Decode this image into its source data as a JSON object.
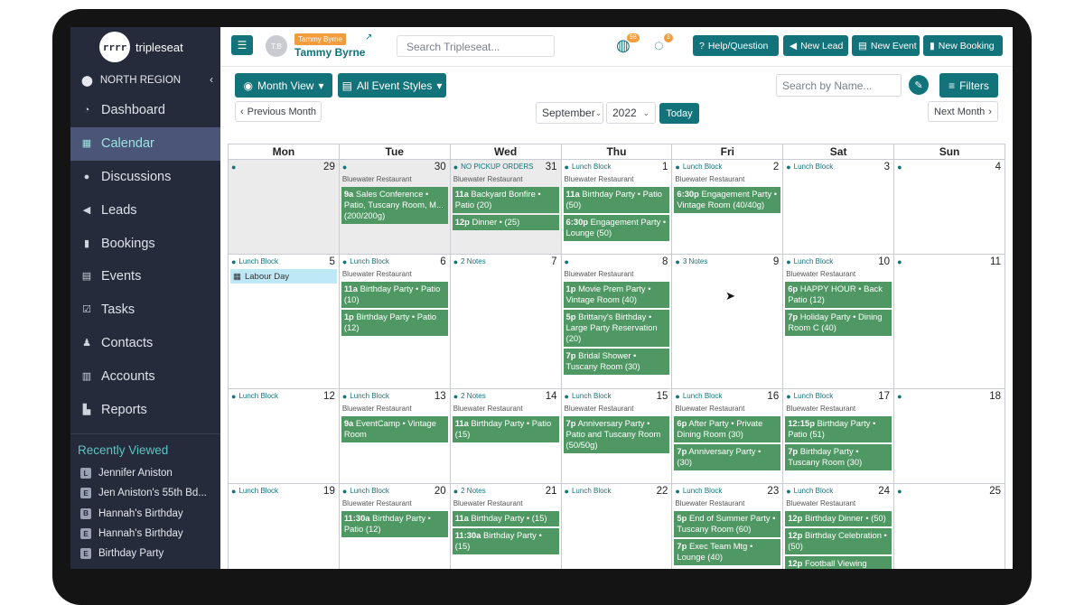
{
  "app": {
    "logo_mark": "rrrr",
    "logo_text": "tripleseat"
  },
  "sidebar": {
    "region": "NORTH REGION",
    "items": [
      {
        "label": "Dashboard",
        "icon": "gauge-icon",
        "glyph": "◔"
      },
      {
        "label": "Calendar",
        "icon": "calendar-icon",
        "glyph": "▦",
        "active": true
      },
      {
        "label": "Discussions",
        "icon": "chat-icon",
        "glyph": "●"
      },
      {
        "label": "Leads",
        "icon": "megaphone-icon",
        "glyph": "◀"
      },
      {
        "label": "Bookings",
        "icon": "bookmark-icon",
        "glyph": "▮"
      },
      {
        "label": "Events",
        "icon": "document-icon",
        "glyph": "▤"
      },
      {
        "label": "Tasks",
        "icon": "checkbox-icon",
        "glyph": "☑"
      },
      {
        "label": "Contacts",
        "icon": "users-icon",
        "glyph": "♟"
      },
      {
        "label": "Accounts",
        "icon": "building-icon",
        "glyph": "▥"
      },
      {
        "label": "Reports",
        "icon": "chart-icon",
        "glyph": "▙"
      }
    ],
    "recent_title": "Recently Viewed",
    "recent": [
      {
        "badge": "L",
        "label": "Jennifer Aniston"
      },
      {
        "badge": "E",
        "label": "Jen Aniston's 55th Bd..."
      },
      {
        "badge": "B",
        "label": "Hannah's Birthday"
      },
      {
        "badge": "E",
        "label": "Hannah's Birthday"
      },
      {
        "badge": "E",
        "label": "Birthday Party"
      }
    ]
  },
  "topbar": {
    "avatar": "T.B",
    "user_badge": "Tammy Byrne",
    "user_name": "Tammy Byrne",
    "search_placeholder": "Search Tripleseat...",
    "notif_count_1": "98",
    "notif_count_2": "3",
    "help": "Help/Question",
    "new_lead": "New Lead",
    "new_event": "New Event",
    "new_booking": "New Booking"
  },
  "toolbar": {
    "month_view": "Month View",
    "event_styles": "All Event Styles",
    "prev_month": "Previous Month",
    "next_month": "Next Month",
    "month": "September",
    "year": "2022",
    "today": "Today",
    "name_search_placeholder": "Search by Name...",
    "filters": "Filters"
  },
  "calendar": {
    "days": [
      "Mon",
      "Tue",
      "Wed",
      "Thu",
      "Fri",
      "Sat",
      "Sun"
    ],
    "weeks": [
      [
        {
          "num": "29",
          "note": "",
          "grey": true,
          "venue": "",
          "events": []
        },
        {
          "num": "30",
          "note": "",
          "grey": true,
          "venue": "Bluewater Restaurant",
          "events": [
            {
              "t": "9a",
              "d": "Sales Conference • Patio, Tuscany Room, M... (200/200g)"
            }
          ]
        },
        {
          "num": "31",
          "note": "NO PICKUP ORDERS",
          "grey": true,
          "venue": "Bluewater Restaurant",
          "events": [
            {
              "t": "11a",
              "d": "Backyard Bonfire • Patio (20)"
            },
            {
              "t": "12p",
              "d": "Dinner • (25)"
            }
          ]
        },
        {
          "num": "1",
          "note": "Lunch Block",
          "venue": "Bluewater Restaurant",
          "events": [
            {
              "t": "11a",
              "d": "Birthday Party • Patio (50)"
            },
            {
              "t": "6:30p",
              "d": "Engagement Party • Lounge (50)"
            }
          ]
        },
        {
          "num": "2",
          "note": "Lunch Block",
          "venue": "Bluewater Restaurant",
          "events": [
            {
              "t": "6:30p",
              "d": "Engagement Party • Vintage Room (40/40g)"
            }
          ]
        },
        {
          "num": "3",
          "note": "Lunch Block",
          "venue": "",
          "events": []
        },
        {
          "num": "4",
          "note": "",
          "venue": "",
          "events": []
        }
      ],
      [
        {
          "num": "5",
          "note": "Lunch Block",
          "venue": "",
          "holiday": "Labour Day",
          "events": []
        },
        {
          "num": "6",
          "note": "Lunch Block",
          "venue": "Bluewater Restaurant",
          "events": [
            {
              "t": "11a",
              "d": "Birthday Party • Patio (10)"
            },
            {
              "t": "1p",
              "d": "Birthday Party • Patio (12)"
            }
          ]
        },
        {
          "num": "7",
          "note": "2 Notes",
          "venue": "",
          "events": []
        },
        {
          "num": "8",
          "note": "",
          "venue": "Bluewater Restaurant",
          "events": [
            {
              "t": "1p",
              "d": "Movie Prem Party • Vintage Room (40)"
            },
            {
              "t": "5p",
              "d": "Brittany's Birthday • Large Party Reservation (20)"
            },
            {
              "t": "7p",
              "d": "Bridal Shower • Tuscany Room (30)"
            }
          ]
        },
        {
          "num": "9",
          "note": "3 Notes",
          "venue": "",
          "events": []
        },
        {
          "num": "10",
          "note": "Lunch Block",
          "venue": "Bluewater Restaurant",
          "events": [
            {
              "t": "6p",
              "d": "HAPPY HOUR • Back Patio (12)"
            },
            {
              "t": "7p",
              "d": "Holiday Party • Dining Room C (40)"
            }
          ]
        },
        {
          "num": "11",
          "note": "",
          "venue": "",
          "events": []
        }
      ],
      [
        {
          "num": "12",
          "note": "Lunch Block",
          "venue": "",
          "events": []
        },
        {
          "num": "13",
          "note": "Lunch Block",
          "venue": "Bluewater Restaurant",
          "events": [
            {
              "t": "9a",
              "d": "EventCamp • Vintage Room"
            }
          ]
        },
        {
          "num": "14",
          "note": "2 Notes",
          "venue": "Bluewater Restaurant",
          "events": [
            {
              "t": "11a",
              "d": "Birthday Party • Patio (15)"
            }
          ]
        },
        {
          "num": "15",
          "note": "Lunch Block",
          "venue": "Bluewater Restaurant",
          "events": [
            {
              "t": "7p",
              "d": "Anniversary Party • Patio and Tuscany Room (50/50g)"
            }
          ]
        },
        {
          "num": "16",
          "note": "Lunch Block",
          "venue": "Bluewater Restaurant",
          "events": [
            {
              "t": "6p",
              "d": "After Party • Private Dining Room (30)"
            },
            {
              "t": "7p",
              "d": "Anniversary Party • (30)"
            }
          ]
        },
        {
          "num": "17",
          "note": "Lunch Block",
          "venue": "Bluewater Restaurant",
          "events": [
            {
              "t": "12:15p",
              "d": "Birthday Party • Patio (51)"
            },
            {
              "t": "7p",
              "d": "Birthday Party • Tuscany Room (30)"
            }
          ]
        },
        {
          "num": "18",
          "note": "",
          "venue": "",
          "events": []
        }
      ],
      [
        {
          "num": "19",
          "note": "Lunch Block",
          "venue": "",
          "events": []
        },
        {
          "num": "20",
          "note": "Lunch Block",
          "venue": "Bluewater Restaurant",
          "events": [
            {
              "t": "11:30a",
              "d": "Birthday Party • Patio (12)"
            }
          ]
        },
        {
          "num": "21",
          "note": "2 Notes",
          "venue": "Bluewater Restaurant",
          "events": [
            {
              "t": "11a",
              "d": "Birthday Party • (15)"
            },
            {
              "t": "11:30a",
              "d": "Birthday Party • (15)"
            }
          ]
        },
        {
          "num": "22",
          "note": "Lunch Block",
          "venue": "",
          "events": []
        },
        {
          "num": "23",
          "note": "Lunch Block",
          "venue": "Bluewater Restaurant",
          "events": [
            {
              "t": "5p",
              "d": "End of Summer Party • Tuscany Room (60)"
            },
            {
              "t": "7p",
              "d": "Exec Team Mtg • Lounge (40)"
            }
          ]
        },
        {
          "num": "24",
          "note": "Lunch Block",
          "venue": "Bluewater Restaurant",
          "events": [
            {
              "t": "12p",
              "d": "Birthday Dinner • (50)"
            },
            {
              "t": "12p",
              "d": "Birthday Celebration • (50)"
            },
            {
              "t": "12p",
              "d": "Football Viewing"
            }
          ]
        },
        {
          "num": "25",
          "note": "",
          "venue": "",
          "events": []
        }
      ]
    ]
  }
}
